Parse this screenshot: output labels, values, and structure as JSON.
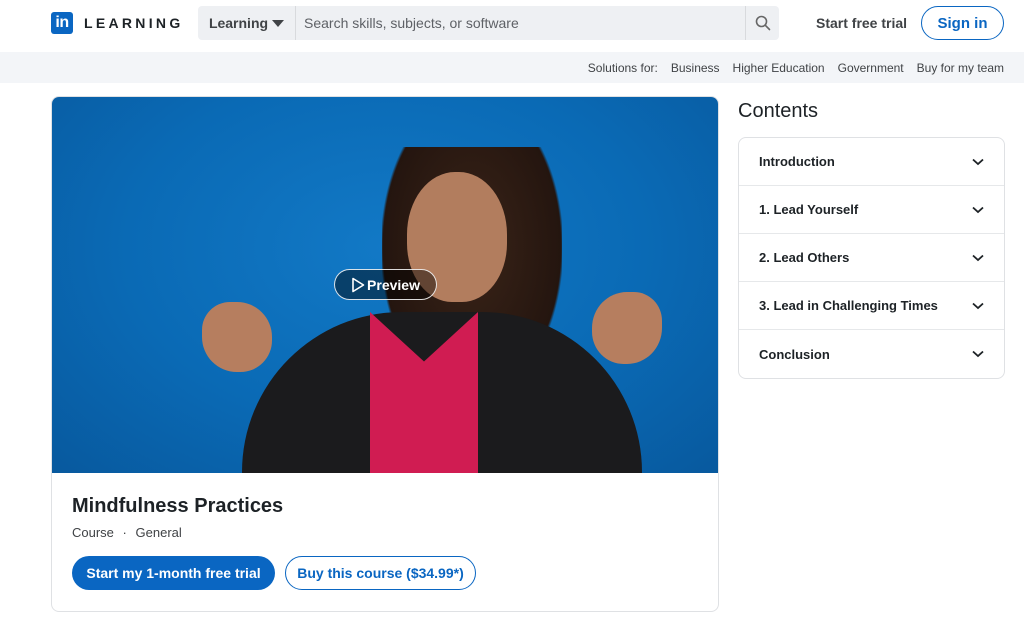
{
  "header": {
    "logo_mark": "in",
    "logo_text": "LEARNING",
    "search_scope": "Learning",
    "search_placeholder": "Search skills, subjects, or software",
    "start_free_trial": "Start free trial",
    "sign_in": "Sign in"
  },
  "subnav": {
    "label": "Solutions for:",
    "links": [
      "Business",
      "Higher Education",
      "Government",
      "Buy for my team"
    ]
  },
  "course": {
    "preview_label": "Preview",
    "title": "Mindfulness Practices",
    "type": "Course",
    "separator": "·",
    "category": "General",
    "primary_cta": "Start my 1-month free trial",
    "secondary_cta": "Buy this course ($34.99*)"
  },
  "contents": {
    "title": "Contents",
    "items": [
      {
        "label": "Introduction"
      },
      {
        "label": "1. Lead Yourself"
      },
      {
        "label": "2. Lead Others"
      },
      {
        "label": "3. Lead in Challenging Times"
      },
      {
        "label": "Conclusion"
      }
    ]
  },
  "colors": {
    "brand": "#0a66c2",
    "hero_background": "#0a6ab5"
  }
}
